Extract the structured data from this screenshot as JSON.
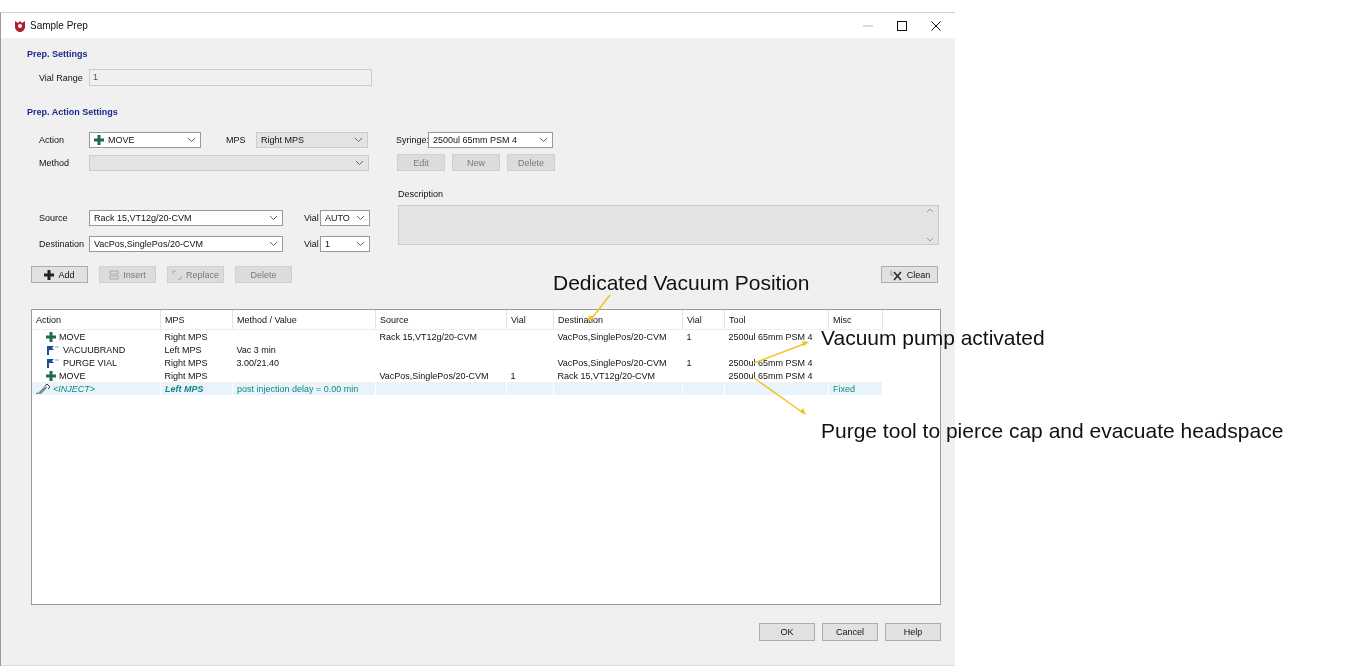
{
  "window": {
    "title": "Sample Prep"
  },
  "prep_settings": {
    "title": "Prep. Settings",
    "vial_range": {
      "label": "Vial Range",
      "value": "1",
      "disabled": true
    }
  },
  "action_settings": {
    "title": "Prep. Action Settings",
    "action": {
      "label": "Action",
      "value": "MOVE",
      "kind": "move"
    },
    "mps": {
      "label": "MPS",
      "value": "Right MPS",
      "disabled": true
    },
    "syringe": {
      "label": "Syringe:",
      "value": "2500ul 65mm PSM 4"
    },
    "method": {
      "label": "Method",
      "disabled": true
    },
    "method_buttons": [
      {
        "label": "Edit",
        "disabled": true
      },
      {
        "label": "New",
        "disabled": true
      },
      {
        "label": "Delete",
        "disabled": true
      }
    ],
    "description": {
      "label": "Description",
      "disabled": true
    },
    "source": {
      "label": "Source",
      "value": "Rack 15,VT12g/20-CVM",
      "vial_label": "Vial",
      "vial": "AUTO"
    },
    "destination": {
      "label": "Destination",
      "value": "VacPos,SinglePos/20-CVM",
      "vial_label": "Vial",
      "vial": "1"
    },
    "list_buttons": [
      {
        "label": "Add",
        "kind": "add",
        "disabled": false
      },
      {
        "label": "Insert",
        "kind": "insert",
        "disabled": true
      },
      {
        "label": "Replace",
        "kind": "replace",
        "disabled": true
      },
      {
        "label": "Delete",
        "kind": "delete",
        "disabled": true
      }
    ],
    "clean_button": {
      "label": "Clean"
    }
  },
  "table": {
    "columns": [
      "Action",
      "MPS",
      "Method / Value",
      "Source",
      "Vial",
      "Destination",
      "Vial",
      "Tool",
      "Misc"
    ],
    "rows": [
      {
        "kind": "move",
        "selected": false,
        "cells": {
          "action": "MOVE",
          "mps": "Right MPS",
          "source": "Rack 15,VT12g/20-CVM",
          "destination": "VacPos,SinglePos/20-CVM",
          "destination_vial": "1",
          "tool": "2500ul 65mm PSM 4"
        }
      },
      {
        "kind": "vacuum",
        "selected": false,
        "cells": {
          "action": "VACUUBRAND",
          "mps": "Left MPS",
          "method": "Vac 3 min"
        }
      },
      {
        "kind": "purge",
        "selected": false,
        "cells": {
          "action": "PURGE VIAL",
          "mps": "Right MPS",
          "method": "3.00/21.40",
          "destination": "VacPos,SinglePos/20-CVM",
          "destination_vial": "1",
          "tool": "2500ul 65mm PSM 4"
        }
      },
      {
        "kind": "move",
        "selected": false,
        "cells": {
          "action": "MOVE",
          "mps": "Right MPS",
          "source": "VacPos,SinglePos/20-CVM",
          "source_vial": "1",
          "destination": "Rack 15,VT12g/20-CVM",
          "tool": "2500ul 65mm PSM 4"
        }
      },
      {
        "kind": "inject",
        "selected": true,
        "cells": {
          "action": "<INJECT>",
          "mps": "Left MPS",
          "method": "post injection delay = 0.00 min",
          "misc": "Fixed"
        }
      }
    ]
  },
  "footer_buttons": [
    "OK",
    "Cancel",
    "Help"
  ],
  "annotations": [
    "Dedicated Vacuum Position",
    "Vacuum pump activated",
    "Purge tool to pierce cap and evacuate headspace"
  ]
}
